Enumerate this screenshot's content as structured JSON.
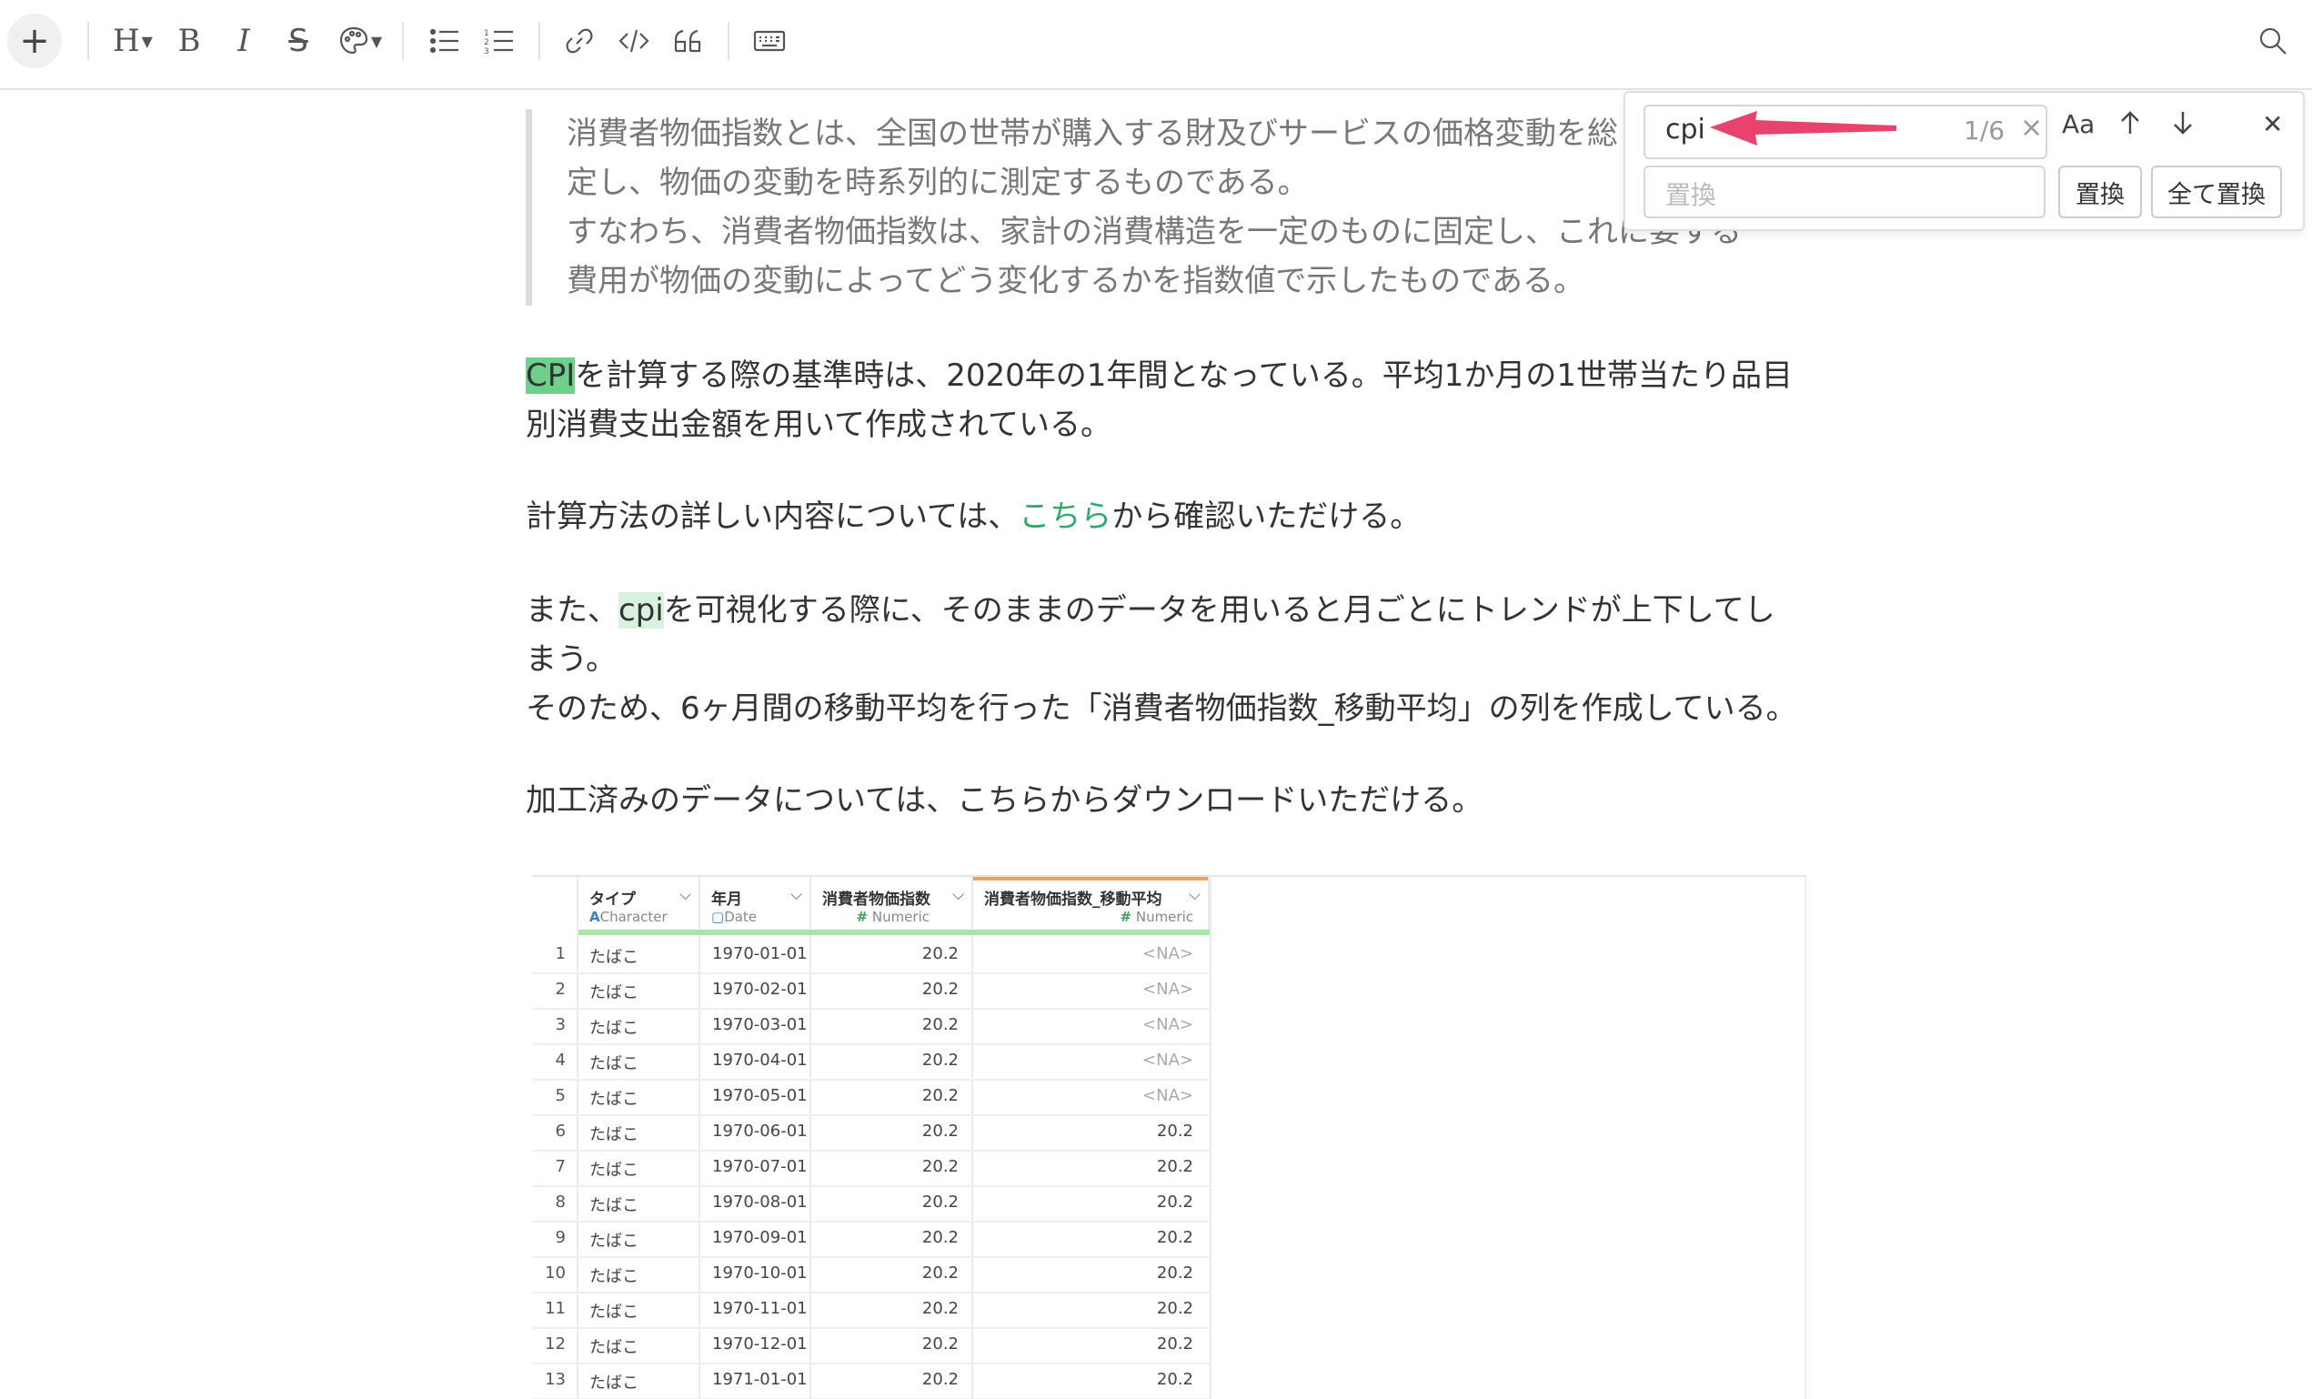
{
  "toolbar": {
    "add": "+",
    "heading": "H",
    "bold": "B",
    "italic": "I",
    "strike": "S"
  },
  "find_panel": {
    "query": "cpi",
    "count": "1/6",
    "clear": "×",
    "match_case": "Aa",
    "replace_placeholder": "置換",
    "replace_button": "置換",
    "replace_all_button": "全て置換",
    "close": "✕"
  },
  "quote": {
    "line1": "消費者物価指数とは、全国の世帯が購入する財及びサービスの価格変動を総",
    "line2": "定し、物価の変動を時系列的に測定するものである。",
    "line3": "すなわち、消費者物価指数は、家計の消費構造を一定のものに固定し、これに要する",
    "line4": "費用が物価の変動によってどう変化するかを指数値で示したものである。"
  },
  "p1": {
    "hl": "CPI",
    "rest1": "を計算する際の基準時は、2020年の1年間となっている。平均1か月の1世帯当たり品目",
    "rest2": "別消費支出金額を用いて作成されている。"
  },
  "p2": {
    "pre": "計算方法の詳しい内容については、",
    "link": "こちら",
    "post": "から確認いただける。"
  },
  "p3": {
    "pre": "また、",
    "hl": "cpi",
    "rest1": "を可視化する際に、そのままのデータを用いると月ごとにトレンドが上下してし",
    "rest2": "まう。",
    "line3": "そのため、6ヶ月間の移動平均を行った「消費者物価指数_移動平均」の列を作成している。"
  },
  "p4": "加工済みのデータについては、こちらからダウンロードいただける。",
  "table": {
    "columns": [
      {
        "name": "タイプ",
        "icon": "A",
        "type": "Character"
      },
      {
        "name": "年月",
        "icon": "▢",
        "type": "Date"
      },
      {
        "name": "消費者物価指数",
        "icon": "#",
        "type": "Numeric"
      },
      {
        "name": "消費者物価指数_移動平均",
        "icon": "#",
        "type": "Numeric"
      }
    ],
    "rows": [
      [
        "1",
        "たばこ",
        "1970-01-01",
        "20.2",
        "<NA>"
      ],
      [
        "2",
        "たばこ",
        "1970-02-01",
        "20.2",
        "<NA>"
      ],
      [
        "3",
        "たばこ",
        "1970-03-01",
        "20.2",
        "<NA>"
      ],
      [
        "4",
        "たばこ",
        "1970-04-01",
        "20.2",
        "<NA>"
      ],
      [
        "5",
        "たばこ",
        "1970-05-01",
        "20.2",
        "<NA>"
      ],
      [
        "6",
        "たばこ",
        "1970-06-01",
        "20.2",
        "20.2"
      ],
      [
        "7",
        "たばこ",
        "1970-07-01",
        "20.2",
        "20.2"
      ],
      [
        "8",
        "たばこ",
        "1970-08-01",
        "20.2",
        "20.2"
      ],
      [
        "9",
        "たばこ",
        "1970-09-01",
        "20.2",
        "20.2"
      ],
      [
        "10",
        "たばこ",
        "1970-10-01",
        "20.2",
        "20.2"
      ],
      [
        "11",
        "たばこ",
        "1970-11-01",
        "20.2",
        "20.2"
      ],
      [
        "12",
        "たばこ",
        "1970-12-01",
        "20.2",
        "20.2"
      ],
      [
        "13",
        "たばこ",
        "1971-01-01",
        "20.2",
        "20.2"
      ]
    ]
  },
  "colors": {
    "highlight_current": "#6fd08c",
    "highlight_other": "#d8f2df",
    "link": "#2eaa6a",
    "annotation_arrow": "#e8436e"
  }
}
